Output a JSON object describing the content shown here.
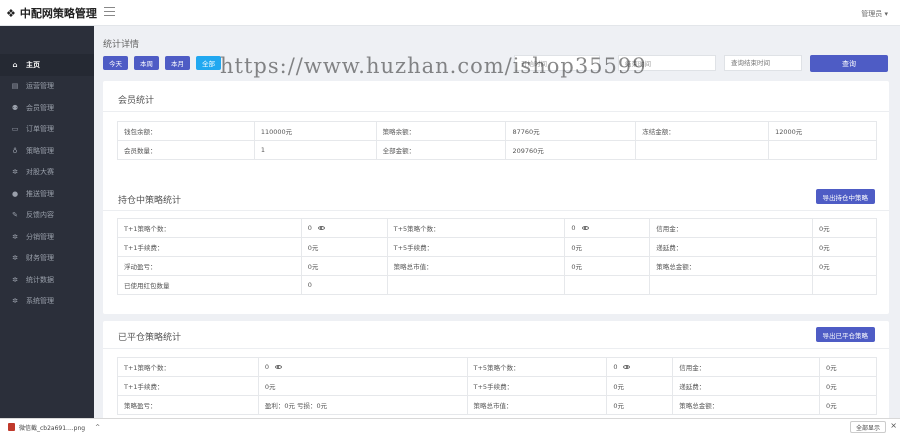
{
  "header": {
    "logo_text": "中配网策略管理",
    "admin_label": "管理员 ▾"
  },
  "sidebar": {
    "items": [
      {
        "label": "主页",
        "icon": "home-icon",
        "glyph": "⌂",
        "active": true
      },
      {
        "label": "运营管理",
        "icon": "dashboard-icon",
        "glyph": "▤"
      },
      {
        "label": "会员管理",
        "icon": "users-icon",
        "glyph": "⚉"
      },
      {
        "label": "订单管理",
        "icon": "order-icon",
        "glyph": "▭"
      },
      {
        "label": "策略管理",
        "icon": "bulb-icon",
        "glyph": "♁"
      },
      {
        "label": "对股大赛",
        "icon": "gear-icon",
        "glyph": "✲"
      },
      {
        "label": "推送管理",
        "icon": "info-icon",
        "glyph": "●"
      },
      {
        "label": "反馈内容",
        "icon": "edit-icon",
        "glyph": "✎"
      },
      {
        "label": "分销管理",
        "icon": "gear-icon",
        "glyph": "✲"
      },
      {
        "label": "财务管理",
        "icon": "gear-icon",
        "glyph": "✲"
      },
      {
        "label": "统计数据",
        "icon": "gear-icon",
        "glyph": "✲"
      },
      {
        "label": "系统管理",
        "icon": "gear-icon",
        "glyph": "✲"
      }
    ]
  },
  "main": {
    "title": "统计详情",
    "filters": {
      "today": "今天",
      "week": "本周",
      "month": "本月",
      "all": "全部"
    },
    "start_time": {
      "value": "开始时间",
      "placeholder": "开始时间"
    },
    "end_time": {
      "value": "结束时间",
      "placeholder": "结束时间"
    },
    "query_placeholder": "查询结束时间",
    "query_btn": "查询"
  },
  "member_stats": {
    "title": "会员统计",
    "rows": [
      [
        "钱包余额：",
        "110000元",
        "策略余额：",
        "87760元",
        "冻结金额：",
        "12000元"
      ],
      [
        "会员数量：",
        "1",
        "全部金额：",
        "209760元",
        "",
        ""
      ]
    ]
  },
  "holding_stats": {
    "title": "持仓中策略统计",
    "export_btn": "导出持仓中策略",
    "rows": [
      [
        "T+1策略个数：",
        "0",
        "T+5策略个数：",
        "0",
        "信用金：",
        "0元"
      ],
      [
        "T+1手续费：",
        "0元",
        "T+5手续费：",
        "0元",
        "递延费：",
        "0元"
      ],
      [
        "浮动盈亏：",
        "0元",
        "策略总市值：",
        "0元",
        "策略总金额：",
        "0元"
      ],
      [
        "已使用红包数量",
        "0",
        "",
        "",
        "",
        ""
      ]
    ]
  },
  "closed_stats": {
    "title": "已平仓策略统计",
    "export_btn": "导出已平仓策略",
    "rows": [
      [
        "T+1策略个数：",
        "0",
        "T+5策略个数：",
        "0",
        "信用金：",
        "0元"
      ],
      [
        "T+1手续费：",
        "0元",
        "T+5手续费：",
        "0元",
        "递延费：",
        "0元"
      ],
      [
        "策略盈亏：",
        "盈利：0元 亏损：0元",
        "策略总市值：",
        "0元",
        "策略总金额：",
        "0元"
      ]
    ]
  },
  "watermark": "https://www.huzhan.com/ishop35599",
  "download_bar": {
    "file_name": "微信截_cb2a691....png",
    "show_all": "全部显示",
    "close": "×"
  }
}
